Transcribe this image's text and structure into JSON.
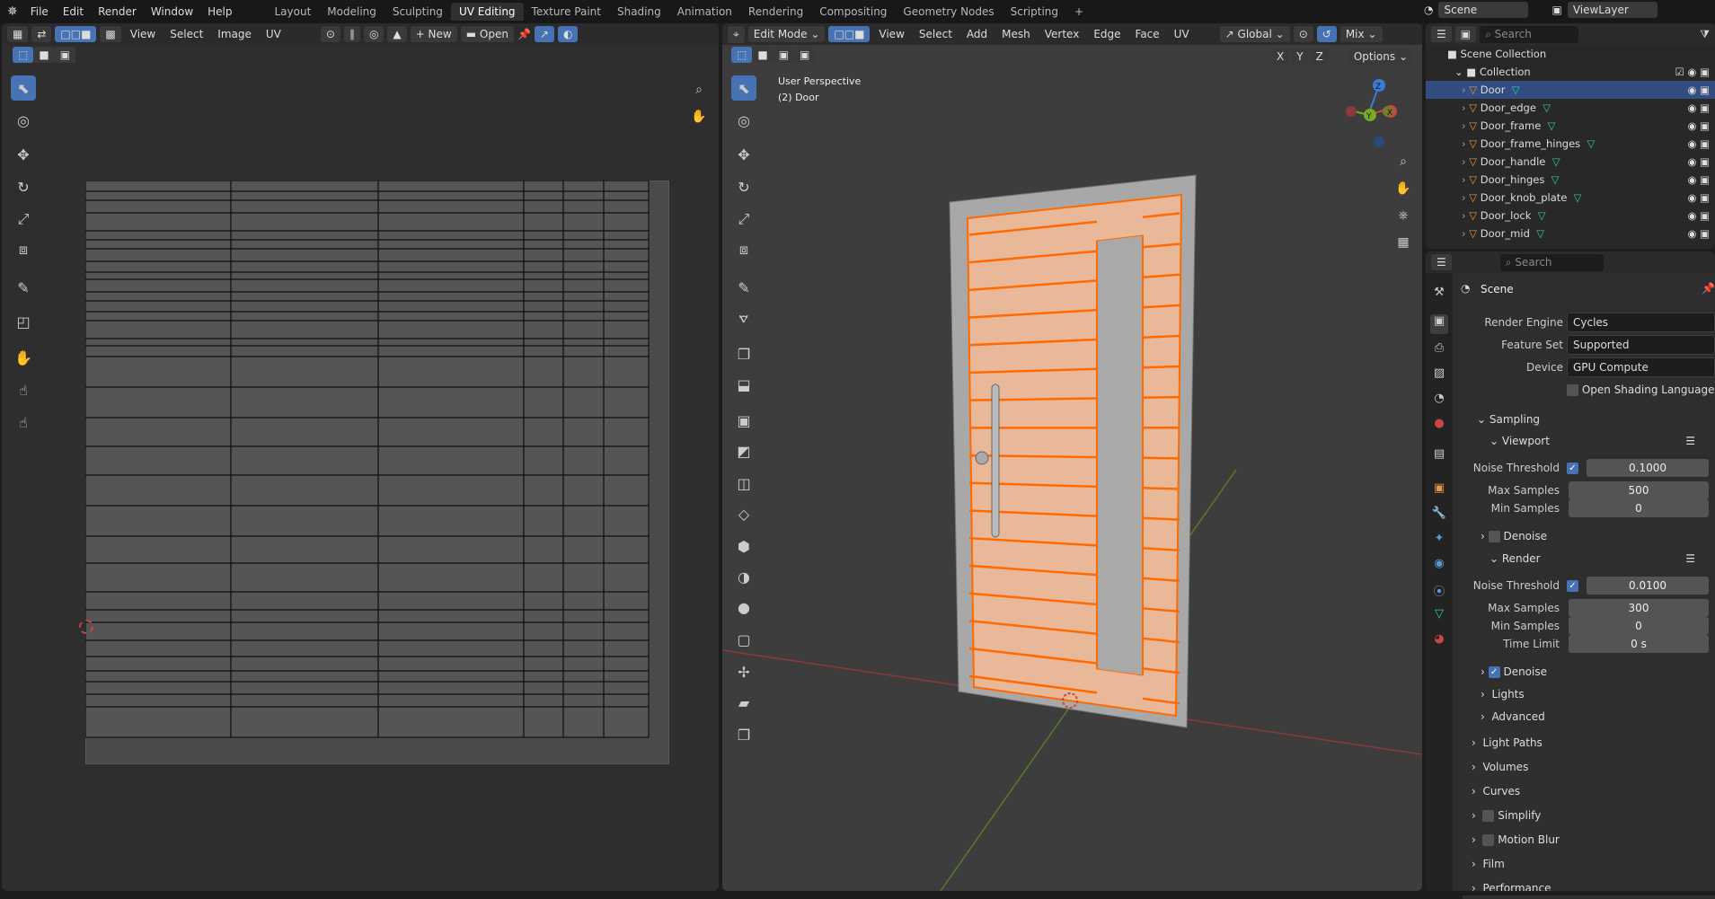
{
  "topbar": {
    "menus": [
      "File",
      "Edit",
      "Render",
      "Window",
      "Help"
    ],
    "workspaces": [
      "Layout",
      "Modeling",
      "Sculpting",
      "UV Editing",
      "Texture Paint",
      "Shading",
      "Animation",
      "Rendering",
      "Compositing",
      "Geometry Nodes",
      "Scripting"
    ],
    "active_workspace": "UV Editing",
    "add_tab": "+",
    "scene": "Scene",
    "view_layer": "ViewLayer"
  },
  "uv_editor": {
    "menus": [
      "View",
      "Select",
      "Image",
      "UV"
    ],
    "new_label": "New",
    "open_label": "Open"
  },
  "viewport": {
    "mode": "Edit Mode",
    "menus": [
      "View",
      "Select",
      "Add",
      "Mesh",
      "Vertex",
      "Edge",
      "Face",
      "UV"
    ],
    "orientation": "Global",
    "shading": "Mix",
    "axes": [
      "X",
      "Y",
      "Z"
    ],
    "options_label": "Options",
    "overlay_title": "User Perspective",
    "overlay_object": "(2) Door",
    "gizmo_axes": [
      "Z",
      "Y",
      "X"
    ]
  },
  "outliner": {
    "search_placeholder": "Search",
    "scene_collection": "Scene Collection",
    "collection": "Collection",
    "items": [
      "Door",
      "Door_edge",
      "Door_frame",
      "Door_frame_hinges",
      "Door_handle",
      "Door_hinges",
      "Door_knob_plate",
      "Door_lock",
      "Door_mid"
    ],
    "selected": "Door"
  },
  "properties": {
    "search_placeholder": "Search",
    "context": "Scene",
    "render_engine": {
      "label": "Render Engine",
      "value": "Cycles"
    },
    "feature_set": {
      "label": "Feature Set",
      "value": "Supported"
    },
    "device": {
      "label": "Device",
      "value": "GPU Compute"
    },
    "osl": {
      "label": "Open Shading Language",
      "checked": false
    },
    "sampling": {
      "label": "Sampling",
      "viewport": {
        "label": "Viewport",
        "noise_label": "Noise Threshold",
        "noise_enabled": true,
        "noise": "0.1000",
        "max_label": "Max Samples",
        "max": "500",
        "min_label": "Min Samples",
        "min": "0",
        "denoise_label": "Denoise",
        "denoise": false
      },
      "render": {
        "label": "Render",
        "noise_label": "Noise Threshold",
        "noise_enabled": true,
        "noise": "0.0100",
        "max_label": "Max Samples",
        "max": "300",
        "min_label": "Min Samples",
        "min": "0",
        "time_label": "Time Limit",
        "time": "0 s",
        "denoise_label": "Denoise",
        "denoise": true
      },
      "lights": "Lights",
      "advanced": "Advanced"
    },
    "panels": [
      "Light Paths",
      "Volumes",
      "Curves",
      "Simplify",
      "Motion Blur",
      "Film",
      "Performance"
    ]
  },
  "colors": {
    "accent": "#4772b3",
    "selection_orange": "#ff6a00",
    "door_face": "#e8b898",
    "bg": "#2e2e2e"
  }
}
